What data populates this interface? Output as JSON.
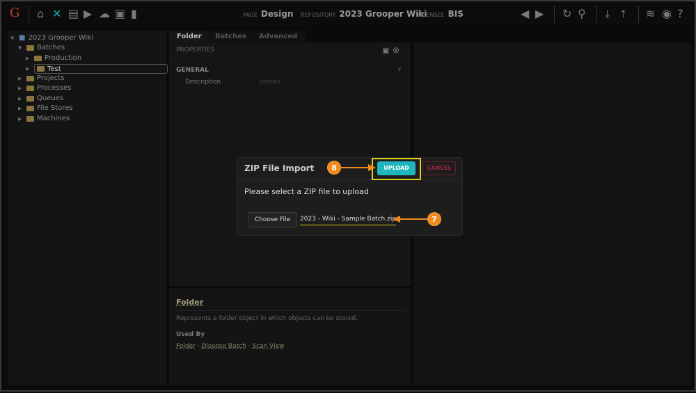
{
  "header": {
    "logo": "G",
    "page_label": "PAGE",
    "page": "Design",
    "repo_label": "REPOSITORY",
    "repo": "2023 Grooper Wiki",
    "licensee_label": "LICENSEE",
    "licensee": "BIS"
  },
  "nav_icons": [
    "home-icon",
    "tools-icon",
    "archive-icon",
    "play-box-icon",
    "cloud-upload-icon",
    "briefcase-clock-icon",
    "chart-icon"
  ],
  "tree": {
    "root": "2023 Grooper Wiki",
    "items": [
      {
        "label": "Batches"
      },
      {
        "label": "Production"
      },
      {
        "label": "Test"
      },
      {
        "label": "Projects"
      },
      {
        "label": "Processes"
      },
      {
        "label": "Queues"
      },
      {
        "label": "File Stores"
      },
      {
        "label": "Machines"
      }
    ]
  },
  "tabs": [
    "Folder",
    "Batches",
    "Advanced"
  ],
  "properties": {
    "title": "PROPERTIES",
    "section": "GENERAL",
    "rows": [
      {
        "name": "Description",
        "value": "(none)"
      }
    ]
  },
  "help": {
    "title": "Folder",
    "description": "Represents a folder object in which objects can be stored.",
    "used_by_label": "Used By",
    "links": [
      "Folder",
      "Dispose Batch",
      "Scan View"
    ],
    "sep": "·"
  },
  "modal": {
    "title": "ZIP File Import",
    "upload": "UPLOAD",
    "cancel": "CANCEL",
    "prompt": "Please select a ZIP file to upload",
    "choose": "Choose File",
    "filename": "2023 - Wiki - Sample Batch.zip"
  },
  "annotations": {
    "step_upload": "8",
    "step_file": "7",
    "color": "#f08a1c",
    "highlight": "#e3d218"
  }
}
